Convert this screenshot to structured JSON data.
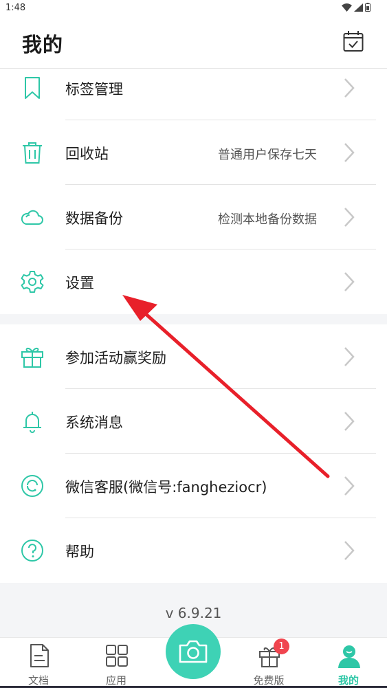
{
  "status": {
    "time": "1:48"
  },
  "header": {
    "title": "我的"
  },
  "menu": {
    "group1": [
      {
        "label": "标签管理",
        "sub": ""
      },
      {
        "label": "回收站",
        "sub": "普通用户保存七天"
      },
      {
        "label": "数据备份",
        "sub": "检测本地备份数据"
      },
      {
        "label": "设置",
        "sub": ""
      }
    ],
    "group2": [
      {
        "label": "参加活动赢奖励"
      },
      {
        "label": "系统消息"
      },
      {
        "label": "微信客服(微信号:fanghezіocr)"
      },
      {
        "label": "帮助"
      }
    ]
  },
  "version": "v 6.9.21",
  "nav": {
    "docs": "文档",
    "apps": "应用",
    "free": "免费版",
    "mine": "我的",
    "badge": "1"
  },
  "colors": {
    "accent": "#3ed2b5",
    "badge": "#f0454f",
    "annotation": "#e8202a"
  }
}
